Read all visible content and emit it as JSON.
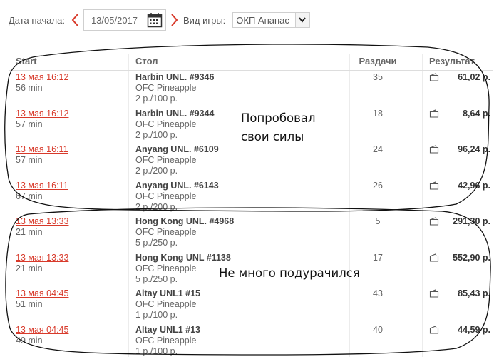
{
  "filters": {
    "start_date_label": "Дата начала:",
    "start_date_value": "13/05/2017",
    "game_type_label": "Вид игры:",
    "game_type_value": "ОКП Ананас"
  },
  "table": {
    "headers": {
      "start": "Start",
      "table": "Стол",
      "hands": "Раздачи",
      "result": "Результат"
    },
    "rows": [
      {
        "start": "13 мая 16:12",
        "duration": "56 min",
        "name": "Harbin UNL. #9346",
        "game": "OFC Pineapple",
        "stakes": "2 р./100 р.",
        "hands": "35",
        "result": "61,02 р."
      },
      {
        "start": "13 мая 16:12",
        "duration": "57 min",
        "name": "Harbin UNL. #9344",
        "game": "OFC Pineapple",
        "stakes": "2 р./100 р.",
        "hands": "18",
        "result": "8,64 р."
      },
      {
        "start": "13 мая 16:11",
        "duration": "57 min",
        "name": "Anyang UNL. #6109",
        "game": "OFC Pineapple",
        "stakes": "2 р./200 р.",
        "hands": "24",
        "result": "96,24 р."
      },
      {
        "start": "13 мая 16:11",
        "duration": "67 min",
        "name": "Anyang UNL. #6143",
        "game": "OFC Pineapple",
        "stakes": "2 р./200 р.",
        "hands": "26",
        "result": "42,96 р."
      },
      {
        "start": "13 мая 13:33",
        "duration": "21 min",
        "name": "Hong Kong UNL. #4968",
        "game": "OFC Pineapple",
        "stakes": "5 р./250 р.",
        "hands": "5",
        "result": "291,30 р."
      },
      {
        "start": "13 мая 13:33",
        "duration": "21 min",
        "name": "Hong Kong UNL #1138",
        "game": "OFC Pineapple",
        "stakes": "5 р./250 р.",
        "hands": "17",
        "result": "552,90 р."
      },
      {
        "start": "13 мая 04:45",
        "duration": "51 min",
        "name": "Altay UNL1 #15",
        "game": "OFC Pineapple",
        "stakes": "1 р./100 р.",
        "hands": "43",
        "result": "85,43 р."
      },
      {
        "start": "13 мая 04:45",
        "duration": "49 min",
        "name": "Altay UNL1 #13",
        "game": "OFC Pineapple",
        "stakes": "1 р./100 р.",
        "hands": "40",
        "result": "44,59 р."
      }
    ]
  },
  "annotations": {
    "note_top": "Попробовал свои силы",
    "note_bottom": "Не много подурачился"
  },
  "colors": {
    "accent": "#d83a2b",
    "text": "#333333",
    "muted": "#666666"
  }
}
